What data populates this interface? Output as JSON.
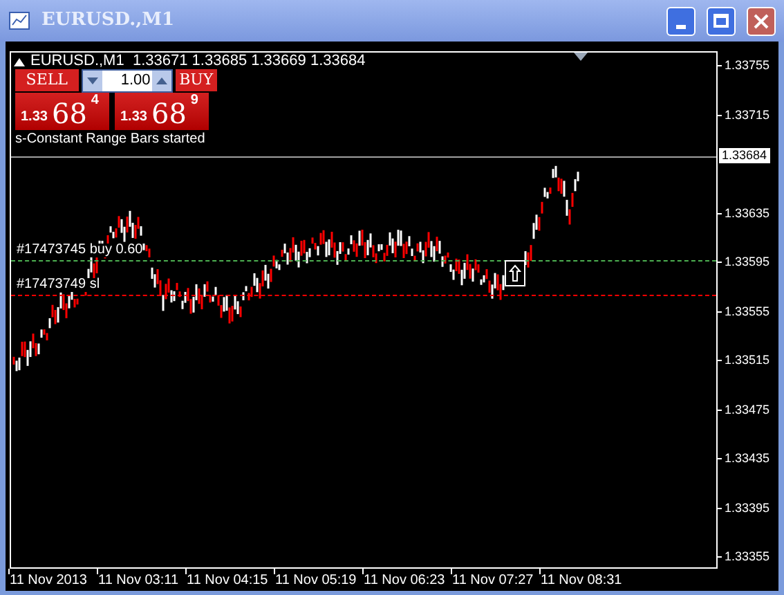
{
  "window": {
    "title": "EURUSD.,M1"
  },
  "chart": {
    "header": {
      "symbol": "EURUSD.,M1",
      "open": "1.33671",
      "high": "1.33685",
      "low": "1.33669",
      "close": "1.33684"
    },
    "trade_panel": {
      "sell_label": "SELL",
      "lot": "1.00",
      "buy_label": "BUY",
      "sell_price": {
        "prefix": "1.33",
        "big": "68",
        "small": "4"
      },
      "buy_price": {
        "prefix": "1.33",
        "big": "68",
        "small": "9"
      }
    },
    "message": "s-Constant Range Bars started",
    "orders": [
      {
        "label": "#17473745 buy 0.60",
        "color": "#4caf50"
      },
      {
        "label": "#17473749 sl",
        "color": "#ff0000"
      }
    ],
    "current_price": "1.33684",
    "y_axis_upper": [
      "1.33755",
      "1.33715"
    ],
    "y_axis_lower": [
      "1.33635",
      "1.33595",
      "1.33555",
      "1.33515",
      "1.33475",
      "1.33435",
      "1.33395",
      "1.33355"
    ],
    "x_axis": [
      "11 Nov 2013",
      "11 Nov 03:11",
      "11 Nov 04:15",
      "11 Nov 05:19",
      "11 Nov 06:23",
      "11 Nov 07:27",
      "11 Nov 08:31"
    ]
  }
}
